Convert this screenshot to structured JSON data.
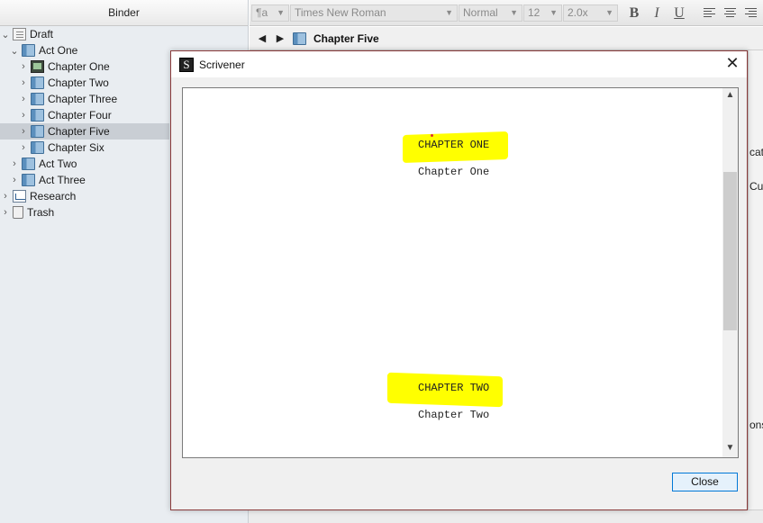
{
  "binder": {
    "header": "Binder",
    "items": [
      {
        "label": "Draft",
        "chevron": "expanded",
        "icon": "draft-icon"
      },
      {
        "label": "Act One",
        "chevron": "expanded",
        "icon": "folder-book-icon"
      },
      {
        "label": "Chapter One",
        "chevron": "collapsed",
        "icon": "scene-document-icon"
      },
      {
        "label": "Chapter Two",
        "chevron": "collapsed",
        "icon": "folder-book-icon"
      },
      {
        "label": "Chapter Three",
        "chevron": "collapsed",
        "icon": "folder-book-icon"
      },
      {
        "label": "Chapter Four",
        "chevron": "collapsed",
        "icon": "folder-book-icon"
      },
      {
        "label": "Chapter Five",
        "chevron": "collapsed",
        "icon": "folder-book-icon",
        "selected": true
      },
      {
        "label": "Chapter Six",
        "chevron": "collapsed",
        "icon": "folder-book-icon"
      },
      {
        "label": "Act Two",
        "chevron": "collapsed",
        "icon": "folder-book-icon"
      },
      {
        "label": "Act Three",
        "chevron": "collapsed",
        "icon": "folder-book-icon"
      },
      {
        "label": "Research",
        "chevron": "collapsed",
        "icon": "research-icon"
      },
      {
        "label": "Trash",
        "chevron": "collapsed",
        "icon": "trash-icon"
      }
    ]
  },
  "format_bar": {
    "style": "¶a",
    "font": "Times New Roman",
    "typeface": "Normal",
    "size": "12",
    "line_spacing": "2.0x",
    "bold": "B",
    "italic": "I",
    "underline": "U"
  },
  "editor": {
    "title": "Chapter Five",
    "back": "◀",
    "forward": "▶"
  },
  "right_pane": {
    "text_1": "cat",
    "text_2": "Cus",
    "text_3": "ons"
  },
  "dialog": {
    "title": "Scrivener",
    "close_glyph": "✕",
    "close_button": "Close",
    "preview": {
      "heading_1": "CHAPTER ONE",
      "subtitle_1": "Chapter One",
      "heading_2": "CHAPTER TWO",
      "subtitle_2": "Chapter Two"
    }
  },
  "colors": {
    "highlight": "#ffff00",
    "selection": "#c9ced4",
    "dialog_border": "#8a3b3b",
    "button_border": "#0078d7"
  }
}
